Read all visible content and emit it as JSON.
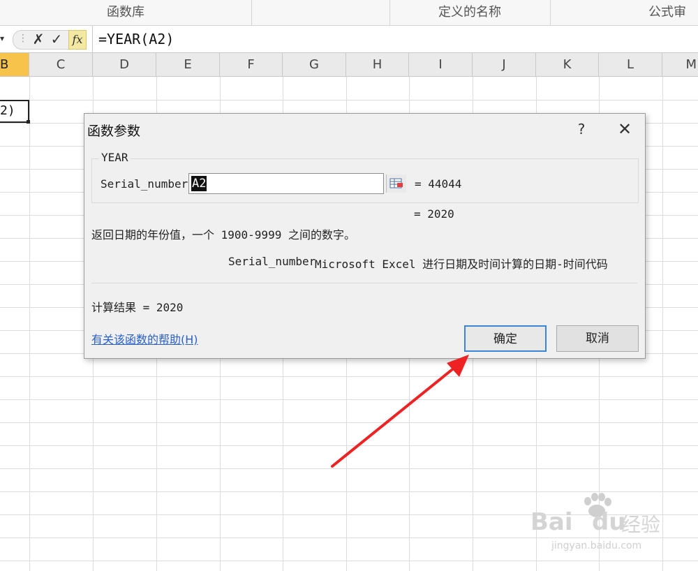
{
  "ribbon": {
    "groups": [
      "函数库",
      "定义的名称",
      "公式审核"
    ]
  },
  "formula_bar": {
    "dropdown": "▾",
    "cancel": "✗",
    "enter": "✓",
    "fx": "fx",
    "content": "=YEAR(A2)"
  },
  "columns": [
    "B",
    "C",
    "D",
    "E",
    "F",
    "G",
    "H",
    "I",
    "J",
    "K",
    "L",
    "M"
  ],
  "selected_column": "B",
  "active_cell": {
    "text": "2)"
  },
  "dialog": {
    "title": "函数参数",
    "help": "?",
    "close": "✕",
    "function_name": "YEAR",
    "argument": {
      "label": "Serial_number",
      "value": "A2",
      "result": "=  44044"
    },
    "function_result": "=  2020",
    "description": "返回日期的年份值，一个 1900-9999 之间的数字。",
    "argument_description": {
      "name": "Serial_number",
      "text": "Microsoft Excel 进行日期及时间计算的日期-时间代码"
    },
    "calc_result": "计算结果 =  2020",
    "help_link": "有关该函数的帮助(H)",
    "ok": "确定",
    "cancel": "取消"
  },
  "colors": {
    "selected_column": "#f7c34a",
    "ok_border": "#3a85d4",
    "link": "#2a60c8",
    "annotation_arrow": "#ee2222"
  },
  "watermark": {
    "brand": "Bai",
    "brand2": "du",
    "suffix": "经验",
    "url": "jingyan.baidu.com"
  }
}
